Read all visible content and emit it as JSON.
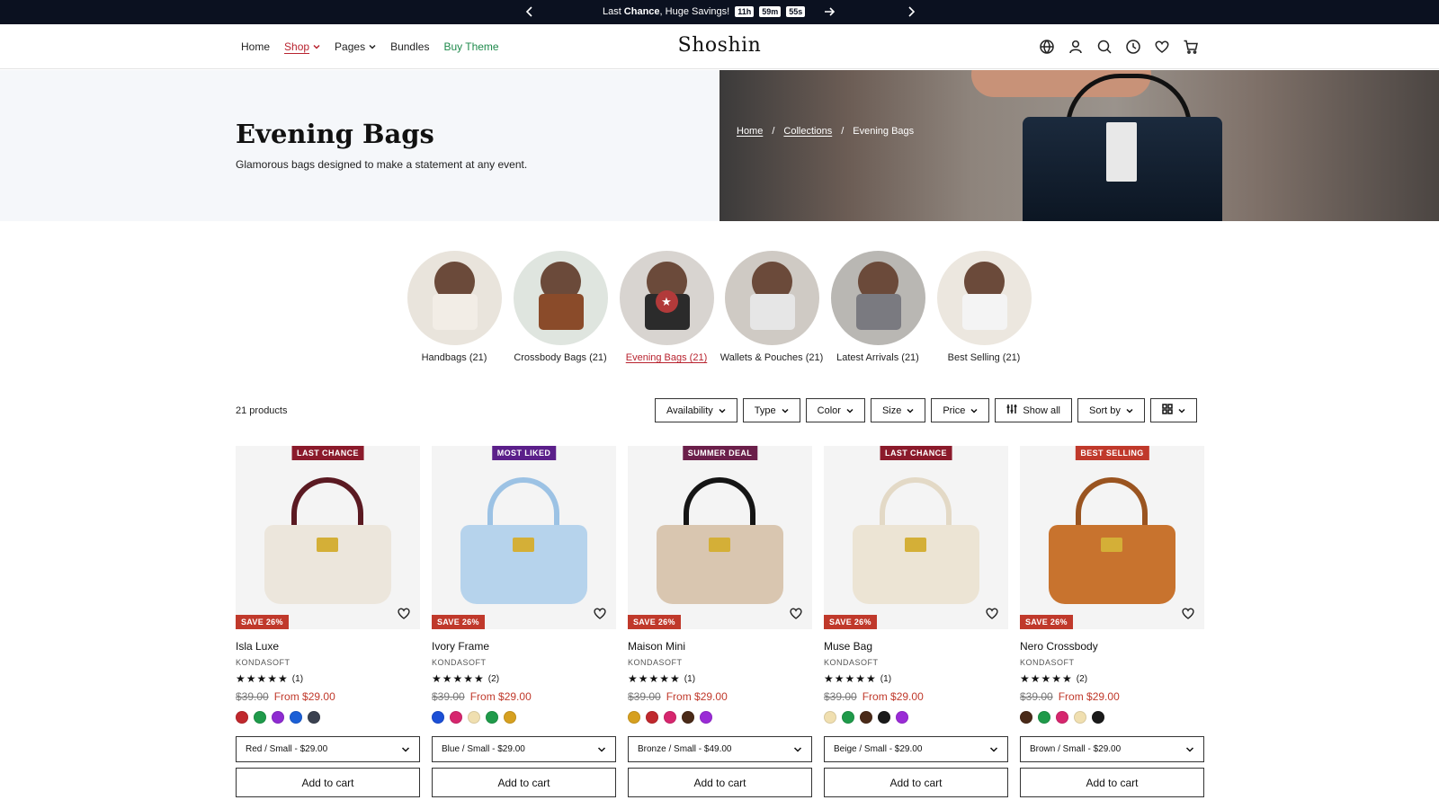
{
  "announcement": {
    "text_pre": "Last",
    "text_bold": "Chance",
    "text_post": ", Huge Savings!",
    "timer": [
      "11h",
      "59m",
      "55s"
    ]
  },
  "nav": {
    "items": [
      {
        "label": "Home"
      },
      {
        "label": "Shop"
      },
      {
        "label": "Pages"
      },
      {
        "label": "Bundles"
      },
      {
        "label": "Buy Theme"
      }
    ]
  },
  "logo": "Shoshin",
  "header_icons": [
    "globe-icon",
    "user-icon",
    "search-icon",
    "clock-icon",
    "heart-icon",
    "cart-icon"
  ],
  "hero": {
    "title": "Evening Bags",
    "subtitle": "Glamorous bags designed to make a statement at any event.",
    "breadcrumbs": [
      "Home",
      "Collections",
      "Evening Bags"
    ]
  },
  "collections": [
    {
      "label": "Handbags (21)",
      "bg": "#e9e4dc",
      "obj": "#f2ede6"
    },
    {
      "label": "Crossbody Bags (21)",
      "bg": "#dfe5df",
      "obj": "#8a4b2a"
    },
    {
      "label": "Evening Bags (21)",
      "bg": "#d8d4d0",
      "obj": "#2b2b2b"
    },
    {
      "label": "Wallets & Pouches (21)",
      "bg": "#cfcac4",
      "obj": "#e6e6e6"
    },
    {
      "label": "Latest Arrivals (21)",
      "bg": "#b9b7b3",
      "obj": "#7a7a80"
    },
    {
      "label": "Best Selling (21)",
      "bg": "#ece7df",
      "obj": "#f4f4f4"
    }
  ],
  "products_count": "21 products",
  "filters": [
    "Availability",
    "Type",
    "Color",
    "Size",
    "Price",
    "Show all",
    "Sort by"
  ],
  "products": [
    {
      "title": "Isla Luxe",
      "vendor": "KONDASOFT",
      "badge": "LAST CHANCE",
      "badge_color": "#8b1a2b",
      "save": "SAVE 26%",
      "stars": "★★★★★",
      "reviews": "(1)",
      "old_price": "$39.00",
      "price": "From $29.00",
      "swatches": [
        "#c0282d",
        "#1f9a4a",
        "#8e2bd1",
        "#1b5fd6",
        "#3a4150"
      ],
      "variant": "Red / Small - $29.00",
      "bag": "#ece6dc",
      "handle": "#5b1a22"
    },
    {
      "title": "Ivory Frame",
      "vendor": "KONDASOFT",
      "badge": "MOST LIKED",
      "badge_color": "#5b1f8a",
      "save": "SAVE 26%",
      "stars": "★★★★★",
      "reviews": "(2)",
      "old_price": "$39.00",
      "price": "From $29.00",
      "swatches": [
        "#1b4fd6",
        "#d6266e",
        "#f0dfb0",
        "#1f9a4a",
        "#d6a020"
      ],
      "variant": "Blue / Small - $29.00",
      "bag": "#b6d3ec",
      "handle": "#9cc2e4"
    },
    {
      "title": "Maison Mini",
      "vendor": "KONDASOFT",
      "badge": "SUMMER DEAL",
      "badge_color": "#6b1f4a",
      "save": "SAVE 26%",
      "stars": "★★★★★",
      "reviews": "(1)",
      "old_price": "$39.00",
      "price": "From $29.00",
      "swatches": [
        "#d6a020",
        "#c0282d",
        "#d6266e",
        "#4a2a18",
        "#9a2bd6"
      ],
      "variant": "Bronze / Small - $49.00",
      "bag": "#d9c6b0",
      "handle": "#151515"
    },
    {
      "title": "Muse Bag",
      "vendor": "KONDASOFT",
      "badge": "LAST CHANCE",
      "badge_color": "#8b1a2b",
      "save": "SAVE 26%",
      "stars": "★★★★★",
      "reviews": "(1)",
      "old_price": "$39.00",
      "price": "From $29.00",
      "swatches": [
        "#f0dfb0",
        "#1f9a4a",
        "#4a2a18",
        "#1a1a1a",
        "#9a2bd6"
      ],
      "variant": "Beige / Small - $29.00",
      "bag": "#ece4d4",
      "handle": "#e3d9c6"
    },
    {
      "title": "Nero Crossbody",
      "vendor": "KONDASOFT",
      "badge": "BEST SELLING",
      "badge_color": "#c0392b",
      "save": "SAVE 26%",
      "stars": "★★★★★",
      "reviews": "(2)",
      "old_price": "$39.00",
      "price": "From $29.00",
      "swatches": [
        "#4a2a18",
        "#1f9a4a",
        "#d6266e",
        "#f0dfb0",
        "#1a1a1a"
      ],
      "variant": "Brown / Small - $29.00",
      "bag": "#c8732e",
      "handle": "#9a5420"
    }
  ],
  "add_to_cart_label": "Add to cart"
}
